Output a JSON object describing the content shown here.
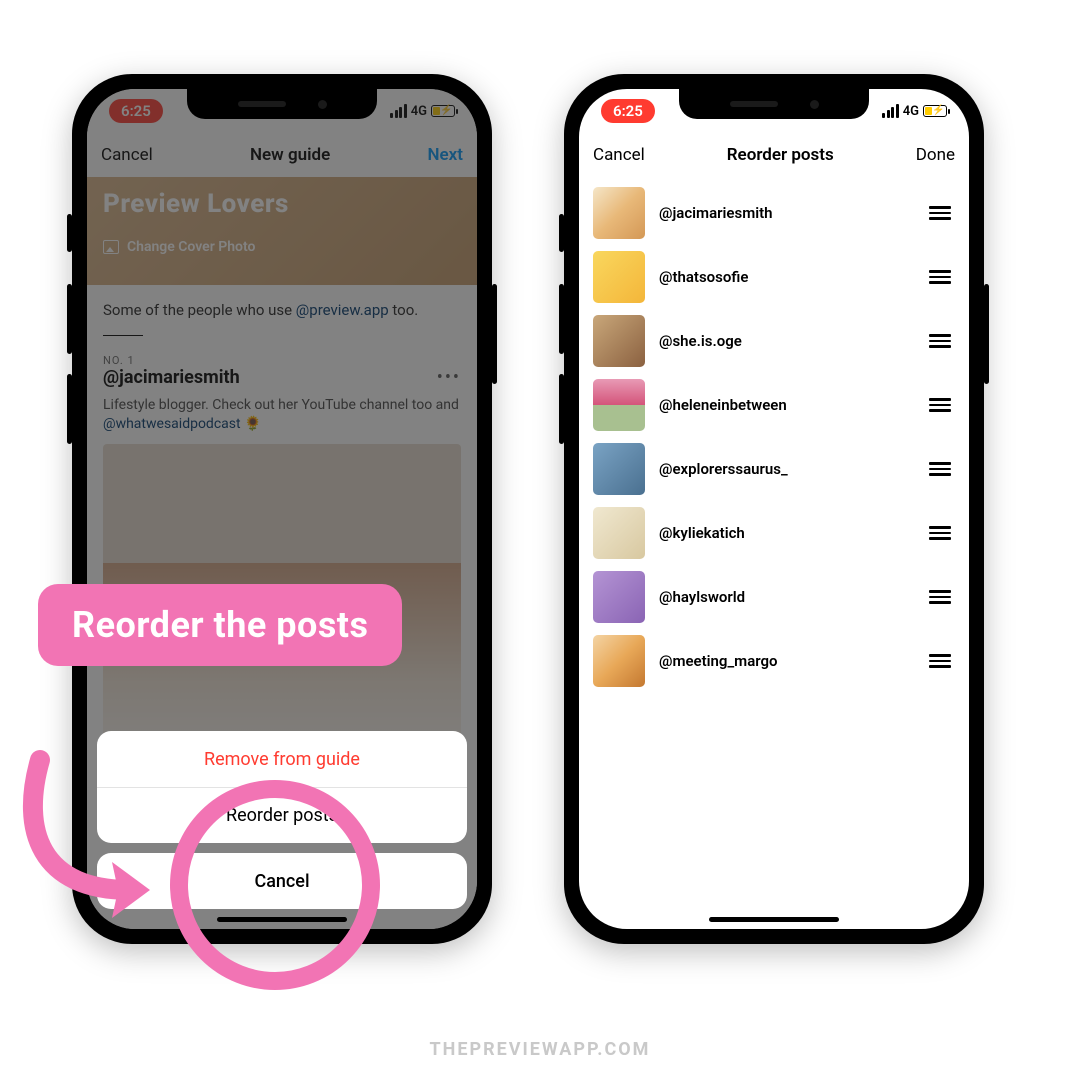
{
  "status": {
    "time": "6:25",
    "network": "4G"
  },
  "tip": {
    "label": "Reorder the posts"
  },
  "watermark": "THEPREVIEWAPP.COM",
  "left": {
    "nav": {
      "cancel": "Cancel",
      "title": "New guide",
      "next": "Next"
    },
    "hero": {
      "title": "Preview Lovers",
      "cover": "Change Cover Photo"
    },
    "desc_prefix": "Some of the people who use ",
    "desc_link": "@preview.app",
    "desc_suffix": " too.",
    "post": {
      "no": "NO. 1",
      "handle": "@jacimariesmith",
      "desc_prefix": "Lifestyle blogger. Check out her YouTube channel too and ",
      "desc_link": "@whatwesaidpodcast",
      "desc_emoji": " 🌻"
    },
    "sheet": {
      "remove": "Remove from guide",
      "reorder": "Reorder posts",
      "cancel": "Cancel"
    }
  },
  "right": {
    "nav": {
      "cancel": "Cancel",
      "title": "Reorder posts",
      "done": "Done"
    },
    "items": [
      {
        "handle": "@jacimariesmith"
      },
      {
        "handle": "@thatsosofie"
      },
      {
        "handle": "@she.is.oge"
      },
      {
        "handle": "@heleneinbetween"
      },
      {
        "handle": "@explorerssaurus_"
      },
      {
        "handle": "@kyliekatich"
      },
      {
        "handle": "@haylsworld"
      },
      {
        "handle": "@meeting_margo"
      }
    ]
  }
}
